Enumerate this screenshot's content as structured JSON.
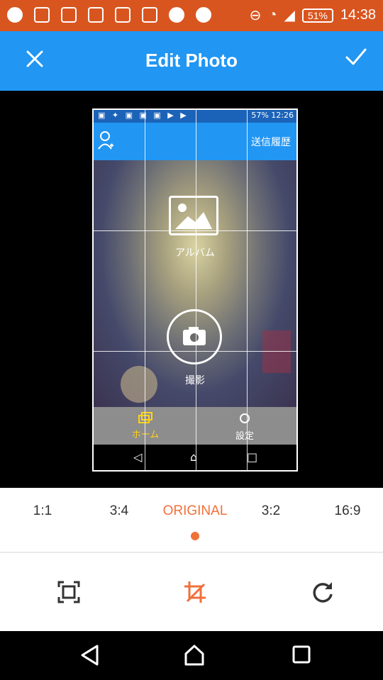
{
  "status_bar": {
    "battery": "51%",
    "time": "14:38"
  },
  "app_bar": {
    "title": "Edit Photo",
    "close_icon": "close-icon",
    "confirm_icon": "check-icon"
  },
  "photo": {
    "status_battery": "57%",
    "status_time": "12:26",
    "header_link": "送信履歴",
    "album_label": "アルバム",
    "camera_label": "撮影",
    "tab_home": "ホーム",
    "tab_settings": "設定"
  },
  "aspect_ratios": {
    "options": [
      "1:1",
      "3:4",
      "ORIGINAL",
      "3:2",
      "16:9"
    ],
    "selected": "ORIGINAL"
  },
  "tools": [
    "fit-icon",
    "crop-icon",
    "rotate-icon"
  ],
  "colors": {
    "status_bar": "#d9551f",
    "app_bar": "#2196f3",
    "accent": "#f0703a"
  }
}
